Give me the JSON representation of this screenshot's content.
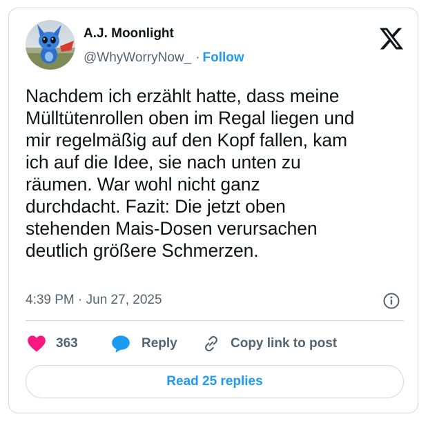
{
  "author": {
    "display_name": "A.J. Moonlight",
    "handle": "@WhyWorryNow_",
    "separator": "·",
    "follow_label": "Follow",
    "avatar_icon": "blue-plush-figure-avatar"
  },
  "tweet": {
    "lines": [
      "Nachdem ich erzählt hatte, dass meine",
      "Mülltütenrollen oben im Regal liegen und",
      "mir regelmäßig auf den Kopf fallen, kam",
      "ich auf die Idee, sie nach unten zu",
      "räumen. War wohl nicht ganz",
      "durchdacht. Fazit: Die jetzt oben",
      "stehenden Mais-Dosen verursachen",
      "deutlich größere Schmerzen."
    ],
    "timestamp": "4:39 PM · Jun 27, 2025"
  },
  "actions": {
    "like_count": "363",
    "reply_label": "Reply",
    "copy_link_label": "Copy link to post"
  },
  "footer": {
    "read_replies_label": "Read 25 replies"
  },
  "icons": {
    "brand": "x-logo-icon",
    "info": "info-icon",
    "like": "heart-icon",
    "reply": "speech-bubble-icon",
    "copy": "link-icon"
  },
  "colors": {
    "accent": "#1d9bf0",
    "like": "#f91880",
    "reply_icon": "#1d9bf0",
    "text": "#0f1419",
    "muted": "#536471",
    "border": "#cfd9de"
  }
}
